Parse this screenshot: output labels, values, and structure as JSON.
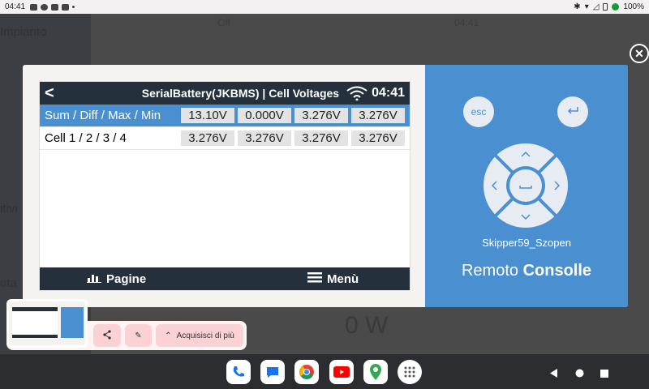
{
  "status_bar": {
    "time": "04:41",
    "battery": "100%"
  },
  "background": {
    "impianto": "Impianto",
    "header_left": "Off",
    "header_right": "04:41",
    "itivi": "itivi",
    "ota": "ota",
    "big_value": "0 W"
  },
  "screen": {
    "back_symbol": "<",
    "title": "SerialBattery(JKBMS) | Cell Voltages",
    "clock": "04:41",
    "rows": [
      {
        "label": "Sum / Diff / Max / Min",
        "values": [
          "13.10V",
          "0.000V",
          "3.276V",
          "3.276V"
        ]
      },
      {
        "label": "Cell 1 / 2 / 3 / 4",
        "values": [
          "3.276V",
          "3.276V",
          "3.276V",
          "3.276V"
        ]
      }
    ],
    "footer": {
      "pages": "Pagine",
      "menu": "Menù"
    }
  },
  "remote": {
    "esc": "esc",
    "enter_icon": "enter-icon",
    "name": "Skipper59_Szopen",
    "title_light": "Remoto",
    "title_bold": "Consolle"
  },
  "preview_actions": {
    "more": "Acquisisci di più"
  },
  "taskbar": {
    "apps": [
      "phone",
      "messages",
      "chrome",
      "youtube",
      "maps",
      "app-drawer"
    ]
  },
  "colors": {
    "accent": "#4a90d1",
    "header": "#25303d"
  }
}
